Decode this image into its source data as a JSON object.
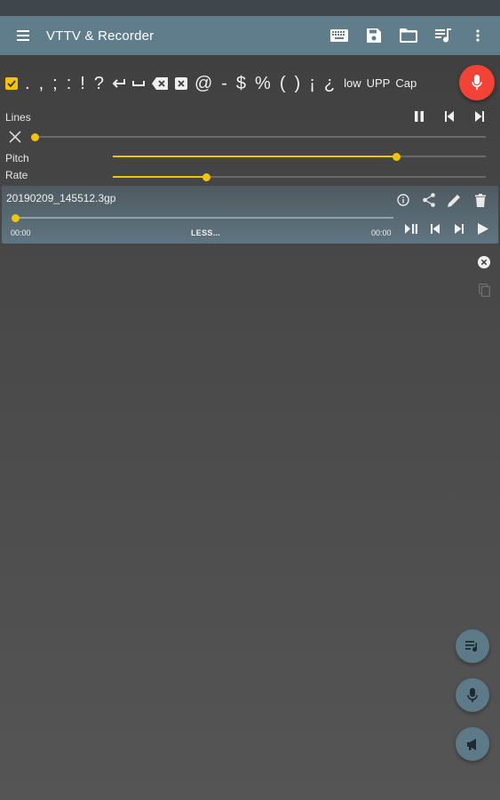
{
  "app": {
    "title": "VTTV & Recorder",
    "accent_color": "#f5c400",
    "toolbar_color": "#607d8b",
    "mic_color": "#f44336",
    "actions": [
      "keyboard-icon",
      "save-icon",
      "folder-icon",
      "playlist-icon",
      "more-vert-icon"
    ]
  },
  "punctuation": {
    "checkbox_checked": true,
    "chars": [
      ".",
      ",",
      ";",
      ":",
      "!",
      "?"
    ],
    "enter_icon": "return-arrow-icon",
    "space_icon": "space-icon",
    "backspace_icon": "backspace-icon",
    "clear_icon": "clear-box-icon",
    "chars2": [
      "@",
      "-",
      "$",
      "%",
      "(",
      ")",
      "¡",
      "¿"
    ],
    "case_buttons": [
      "low",
      "UPP",
      "Cap"
    ]
  },
  "lines": {
    "label": "Lines",
    "position": 0.0
  },
  "pitch": {
    "label": "Pitch",
    "value": 0.76
  },
  "rate": {
    "label": "Rate",
    "value": 0.25
  },
  "recording": {
    "filename": "20190209_145512.3gp",
    "time_current": "00:00",
    "time_total": "00:00",
    "less_label": "LESS...",
    "progress": 0.0
  }
}
